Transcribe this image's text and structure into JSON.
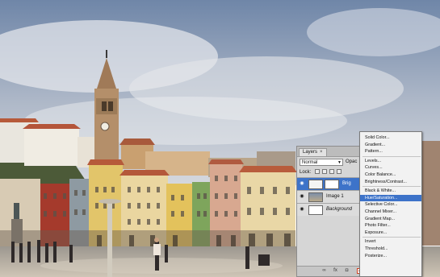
{
  "photo": {
    "sky_top": "#6f86a8",
    "sky_bottom": "#cfd5df",
    "plaza_color": "#b8aea0"
  },
  "layers_panel": {
    "tab_label": "Layers",
    "tab_close": "×",
    "blend_mode": "Normal",
    "opacity_label": "Opac",
    "lock_label": "Lock:",
    "layers": [
      {
        "name": "Brig",
        "selected": true,
        "kind": "adjustment"
      },
      {
        "name": "Image 1",
        "selected": false,
        "kind": "image"
      },
      {
        "name": "Background",
        "selected": false,
        "kind": "background"
      }
    ],
    "footer_icons": [
      "link-icon",
      "fx-icon",
      "mask-icon",
      "adjustment-icon",
      "folder-icon",
      "new-layer-icon",
      "trash-icon"
    ],
    "footer_glyphs": [
      "∞",
      "fx",
      "◘",
      "◐",
      "▭",
      "▢",
      "🗑"
    ]
  },
  "adjustment_menu": {
    "items": [
      "Solid Color...",
      "Gradient...",
      "Pattern...",
      "---",
      "Levels...",
      "Curves...",
      "Color Balance...",
      "Brightness/Contrast...",
      "---",
      "Black & White...",
      "Hue/Saturation...",
      "Selective Color...",
      "Channel Mixer...",
      "Gradient Map...",
      "Photo Filter...",
      "Exposure...",
      "---",
      "Invert",
      "Threshold...",
      "Posterize..."
    ],
    "highlighted": "Hue/Saturation..."
  }
}
